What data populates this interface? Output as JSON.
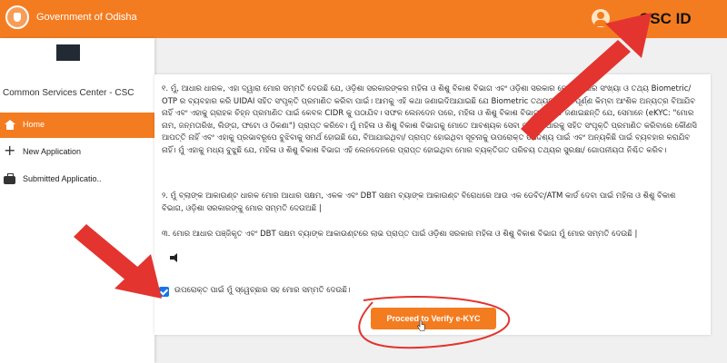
{
  "header": {
    "government_name": "Government of Odisha",
    "csc_id_label": "CSC ID"
  },
  "sidebar": {
    "title": "Common Services Center - CSC",
    "items": [
      {
        "label": "Home",
        "icon": "home-icon",
        "active": true
      },
      {
        "label": "New Application",
        "icon": "plus-icon",
        "active": false
      },
      {
        "label": "Submitted Applicatio..",
        "icon": "briefcase-icon",
        "active": false
      }
    ]
  },
  "consent": {
    "para1": "୧. ମୁଁ, ଆଧାର ଧାରକ, ଏହା ଦ୍ୱାରା ମୋର ସମ୍ମତି ଦେଉଛି ଯେ, ଓଡ଼ିଶା ସରକାରଙ୍କର ମହିଳା ଓ ଶିଶୁ ବିକାଶ ବିଭାଗ ଏବଂ ଓଡ଼ିଶା ସରକାର ମୋର ଆଧାର ସଂଖ୍ୟା ଓ ତଥ୍ୟ Biometric/ OTP ର ବ୍ୟବହାର କରି UIDAI ସହିତ ସଂପୃକ୍ତି ପ୍ରମାଣିତ କରିବା ପାଇଁ। ଆମକୁ ଏହି କଥା ଜଣାଇଦିଆଯାଇଛି ଯେ Biometric ତଥ୍ୟଗୁଡ଼ିକ ସଂପୂର୍ଣ୍ଣ କିମ୍ବା ଆଂଶିକ ଅନ୍ୟତ୍ର ବିଆଯିବ ନାହିଁ ଏବଂ ଏହାକୁ ଗ୍ରାହକ ଚିହ୍ନ ପ୍ରମାଣିତ ପାଇଁ କେବଳ CIDR କୁ ପଠାଯିବ। ସଫଳ ଲେନଦେନ ପରେ, ମହିଳା ଓ ଶିଶୁ ବିକାଶ ବିଭାଗ ମୋତେ ଜଣାଇଛନ୍ତି ଯେ, ସେମାନେ (eKYC: \"ମୋର ନାମ, ଜନ୍ମତାରିଖ, ଲିଙ୍ଗ, ଫଟୋ ଓ ଠିକଣା\") ପ୍ରାପ୍ତ କରିବେ। ମୁଁ ମହିଳା ଓ ଶିଶୁ ବିକାଶ ବିଭାଗକୁ ମୋତେ ଆବଶ୍ୟକ ସେବା ପାଇଁ ଆଧାରକୁ ସହିତ ସଂପୃକ୍ତି ପ୍ରମାଣିତ କରିବାରେ କୌଣସି ଆପତ୍ତି ନାହିଁ ଏବଂ ଏହାକୁ ପ୍ରଭାବରୂପେ ବୁଝିବାକୁ ସମର୍ଥ ହୋଇଛି ଯେ, ବିଆଯାଇଥିବା/ ପ୍ରାପ୍ତ ହୋଇଥିବା ସୂଚନାକୁ ଉପରୋକ୍ତ ଉଦ୍ଦେଶ୍ୟ ପାଇଁ ଏବଂ ଅନ୍ୟକିଛି ପାଇଁ ବ୍ୟବହାର କରାଯିବ ନାହିଁ। ମୁଁ ଏହାକୁ ମଧ୍ୟ ବୁଝୁଛି ଯେ, ମହିଳା ଓ ଶିଶୁ ବିକାଶ ବିଭାଗ ଏହି ଲେନଦେନରେ ପ୍ରାପ୍ତ ହୋଇଥିବା ମୋର ବ୍ୟକ୍ତିଗତ ପରିଚୟ ତଥ୍ୟର ସୁରକ୍ଷା/ ଗୋପନୀୟତା ନିଶ୍ଚିତ କରିବ।",
    "para2": "୨. ମୁଁ ବ୍ଲାଙ୍କ ଆକାଉଣ୍ଟ ଧାରକ ମୋର ଆଧାର ସକ୍ଷମ, ଏକକ ଏବଂ DBT ସକ୍ଷମ ବ୍ୟାଙ୍କ ଆକାଉଣ୍ଟ ବିରୋଧରେ ଆଉ ଏକ ଡେବିଟ୍/ATM କାର୍ଡ ଦେବା ପାଇଁ ମହିଳା ଓ ଶିଶୁ ବିକାଶ ବିଭାଗ, ଓଡ଼ିଶା ସରକାରଙ୍କୁ ମୋର ସମ୍ମତି ଦେଉଅଛି |",
    "para3": "୩. ମୋର ଆଧାର ପଞ୍ଜିକୃତ ଏବଂ DBT ସକ୍ଷମ ବ୍ୟାଙ୍କ ଆକାଉଣ୍ଟରେ ଲାଭ ପ୍ରାପ୍ତ ପାଇଁ ଓଡ଼ିଶା ସରକାର ମହିଳା ଓ ଶିଶୁ ବିକାଶ ବିଭାଗ ମୁଁ ମୋର ସମ୍ମତି ଦେଉଛି |",
    "checkbox_label": "ଉପରୋକ୍ତ ପାଇଁ ମୁଁ ସ୍ୱେଚ୍ଛାର ସହ ମୋର ସମ୍ମତି ଦେଉଛି।",
    "checkbox_checked": true,
    "verify_button_label": "Proceed to Verify e-KYC"
  },
  "colors": {
    "brand_orange": "#f47c20",
    "annotation_red": "#e3342f",
    "checkbox_blue": "#1a73e8"
  }
}
